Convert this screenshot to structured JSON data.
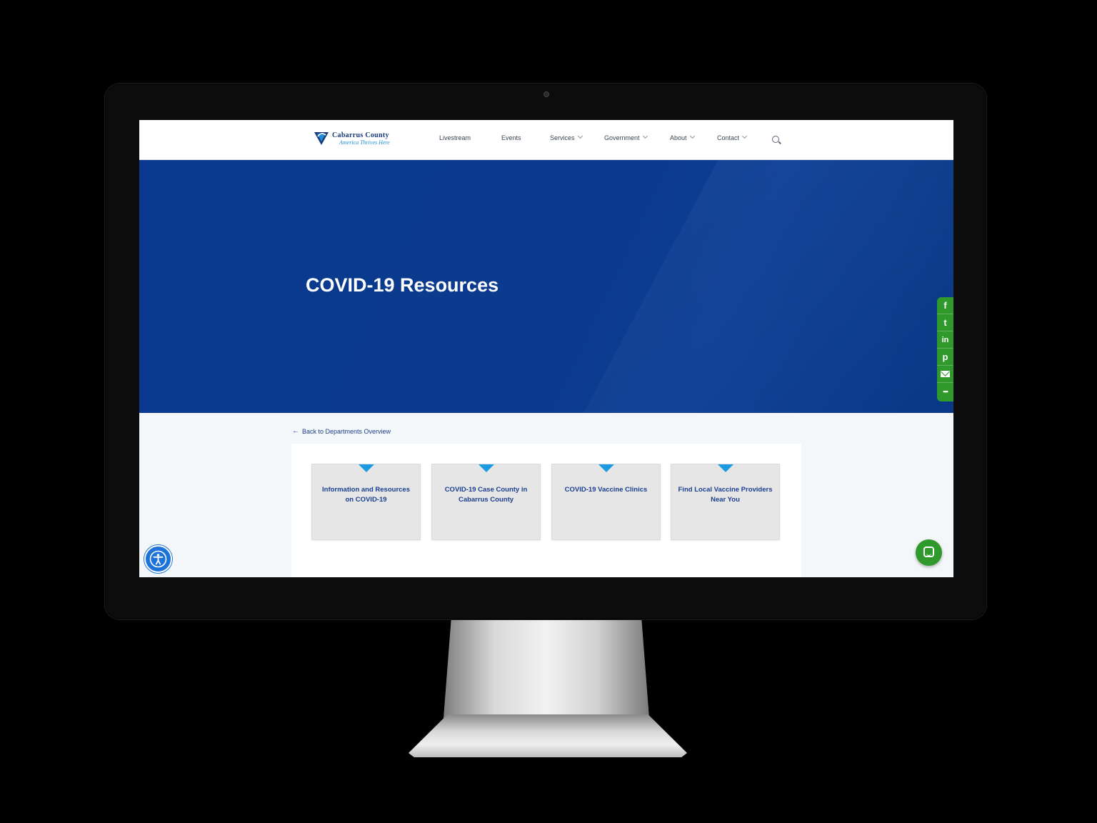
{
  "header": {
    "logo": {
      "title": "Cabarrus County",
      "tagline": "America Thrives Here"
    },
    "nav": [
      {
        "label": "Livestream",
        "has_dropdown": false
      },
      {
        "label": "Events",
        "has_dropdown": false
      },
      {
        "label": "Services",
        "has_dropdown": true
      },
      {
        "label": "Government",
        "has_dropdown": true
      },
      {
        "label": "About",
        "has_dropdown": true
      },
      {
        "label": "Contact",
        "has_dropdown": true
      }
    ],
    "search_icon": "search-icon"
  },
  "hero": {
    "title": "COVID-19 Resources"
  },
  "share": {
    "items": [
      {
        "icon": "facebook-icon",
        "glyph": "f"
      },
      {
        "icon": "twitter-icon",
        "glyph": "t"
      },
      {
        "icon": "linkedin-icon",
        "glyph": "in"
      },
      {
        "icon": "pinterest-icon",
        "glyph": "p"
      },
      {
        "icon": "email-icon",
        "glyph": ""
      },
      {
        "icon": "more-icon",
        "glyph": "•••"
      }
    ]
  },
  "back_link": {
    "arrow": "←",
    "label": "Back to Departments Overview"
  },
  "cards": [
    {
      "label": "Information and Resources on COVID-19"
    },
    {
      "label": "COVID-19 Case County in Cabarrus County"
    },
    {
      "label": "COVID-19 Vaccine Clinics"
    },
    {
      "label": "Find Local Vaccine Providers Near You"
    }
  ],
  "widgets": {
    "accessibility_icon": "accessibility-icon",
    "chat_icon": "chat-icon"
  },
  "colors": {
    "brand_blue": "#0b3a8e",
    "accent_cyan": "#1d9be0",
    "share_green": "#2f9a2b",
    "card_text": "#1a3f8f"
  }
}
